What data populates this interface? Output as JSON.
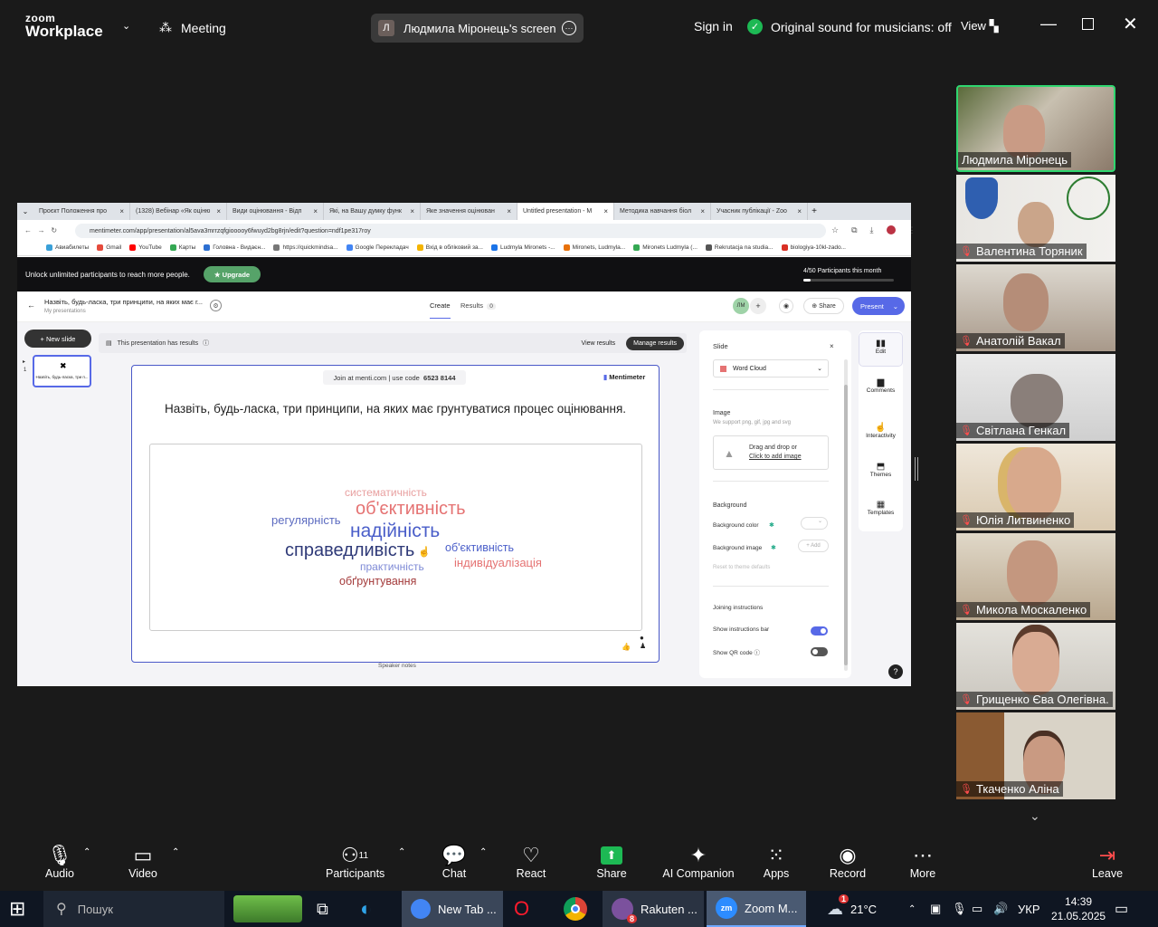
{
  "topbar": {
    "logo_line1": "zoom",
    "logo_line2": "Workplace",
    "meeting_label": "Meeting",
    "share_initial": "Л",
    "share_label": "Людмила Міронець's screen",
    "signin": "Sign in",
    "sound": "Original sound for musicians: off",
    "view": "View"
  },
  "browser": {
    "tabs": [
      {
        "label": "Проєкт Положення про"
      },
      {
        "label": "(1328) Вебінар «Як оціню"
      },
      {
        "label": "Види оцінювання - Відп"
      },
      {
        "label": "Які, на Вашу думку функ"
      },
      {
        "label": "Яке значення оцінюван"
      },
      {
        "label": "Untitled presentation - M"
      },
      {
        "label": "Методика навчання біол"
      },
      {
        "label": "Учасник публікації - Zoo"
      }
    ],
    "url": "mentimeter.com/app/presentation/al5ava3mrrzqfgiooooy6fwuyd2bg8rjn/edit?question=ndf1pe317roy",
    "bookmarks": [
      "Авиабилеты",
      "Gmail",
      "YouTube",
      "Карты",
      "Головна - Видаєн...",
      "https://quickmindsa...",
      "Google Перекладач",
      "Вхід в обліковий за...",
      "Ludmyla Mironets -...",
      "Mironets, Ludmyla...",
      "Mironets Ludmyla (...",
      "Rekrutacja na studia...",
      "biologiya-10kl-zado..."
    ]
  },
  "menti": {
    "promo": "Unlock unlimited participants to reach more people.",
    "upgrade": "★ Upgrade",
    "participants": "4/50  Participants this month",
    "progress": 0.08,
    "title": "Назвіть, будь-ласка, три принципи, на яких має г...",
    "breadcrumb": "My presentations",
    "tab_create": "Create",
    "tab_results": "Results",
    "results_count": "0",
    "avatar": "ЛМ",
    "share": "Share",
    "present": "Present",
    "new_slide": "+ New slide",
    "slide_num": "1",
    "thumb_text": "Назвіть, будь-ласка, три п...",
    "has_results": "This presentation has results",
    "view_results": "View results",
    "manage_results": "Manage results",
    "join_prefix": "Join at menti.com | use code",
    "join_code": "6523 8144",
    "brand": "Mentimeter",
    "question": "Назвіть, будь-ласка, три принципи, на яких має грунтуватися процес оцінювання.",
    "speaker_notes": "Speaker notes",
    "words": [
      {
        "text": "систематичність",
        "color": "#e8a0a0"
      },
      {
        "text": "об'єктивність",
        "color": "#e57373"
      },
      {
        "text": "регулярність",
        "color": "#5c6bc0"
      },
      {
        "text": "надійність",
        "color": "#4a5ec9"
      },
      {
        "text": "справедливість",
        "color": "#2f3a78"
      },
      {
        "text": "об'єктивність",
        "color": "#4a5ec9"
      },
      {
        "text": "практичність",
        "color": "#7e8ad6"
      },
      {
        "text": "індивідуалізація",
        "color": "#e57373"
      },
      {
        "text": "обґрунтування",
        "color": "#a33a3a"
      }
    ],
    "panel": {
      "heading": "Slide",
      "type": "Word Cloud",
      "image_label": "Image",
      "image_hint": "We support png, gif, jpg and svg",
      "drag": "Drag and drop or",
      "click_add": "Click to add image",
      "background": "Background",
      "bg_color": "Background color",
      "bg_image": "Background image",
      "add": "+ Add",
      "reset": "Reset to theme defaults",
      "joining": "Joining instructions",
      "show_bar": "Show instructions bar",
      "show_qr": "Show QR code"
    },
    "tools": [
      "Edit",
      "Comments",
      "Interactivity",
      "Themes",
      "Templates"
    ]
  },
  "participants": [
    {
      "name": "Людмила Міронець",
      "muted": false
    },
    {
      "name": "Валентина Торяник",
      "muted": true
    },
    {
      "name": "Анатолій Вакал",
      "muted": true
    },
    {
      "name": "Світлана Генкал",
      "muted": true
    },
    {
      "name": "Юлія Литвиненко",
      "muted": true
    },
    {
      "name": "Микола Москаленко",
      "muted": true
    },
    {
      "name": "Грищенко Єва Олегівна.",
      "muted": true
    },
    {
      "name": "Ткаченко Аліна",
      "muted": true
    }
  ],
  "toolbar": {
    "audio": "Audio",
    "video": "Video",
    "participants": "Participants",
    "participants_count": "11",
    "chat": "Chat",
    "react": "React",
    "share": "Share",
    "ai": "AI Companion",
    "apps": "Apps",
    "record": "Record",
    "more": "More",
    "leave": "Leave"
  },
  "taskbar": {
    "search": "Пошук",
    "newtab": "New Tab ...",
    "viber": "Rakuten ...",
    "viber_badge": "8",
    "zoom": "Zoom M...",
    "weather": "21°C",
    "weather_badge": "1",
    "lang": "УКР",
    "time": "14:39",
    "date": "21.05.2025"
  },
  "colors": {
    "accent": "#5769e7",
    "share_green": "#1db954",
    "active_speaker": "#2fd66f"
  }
}
